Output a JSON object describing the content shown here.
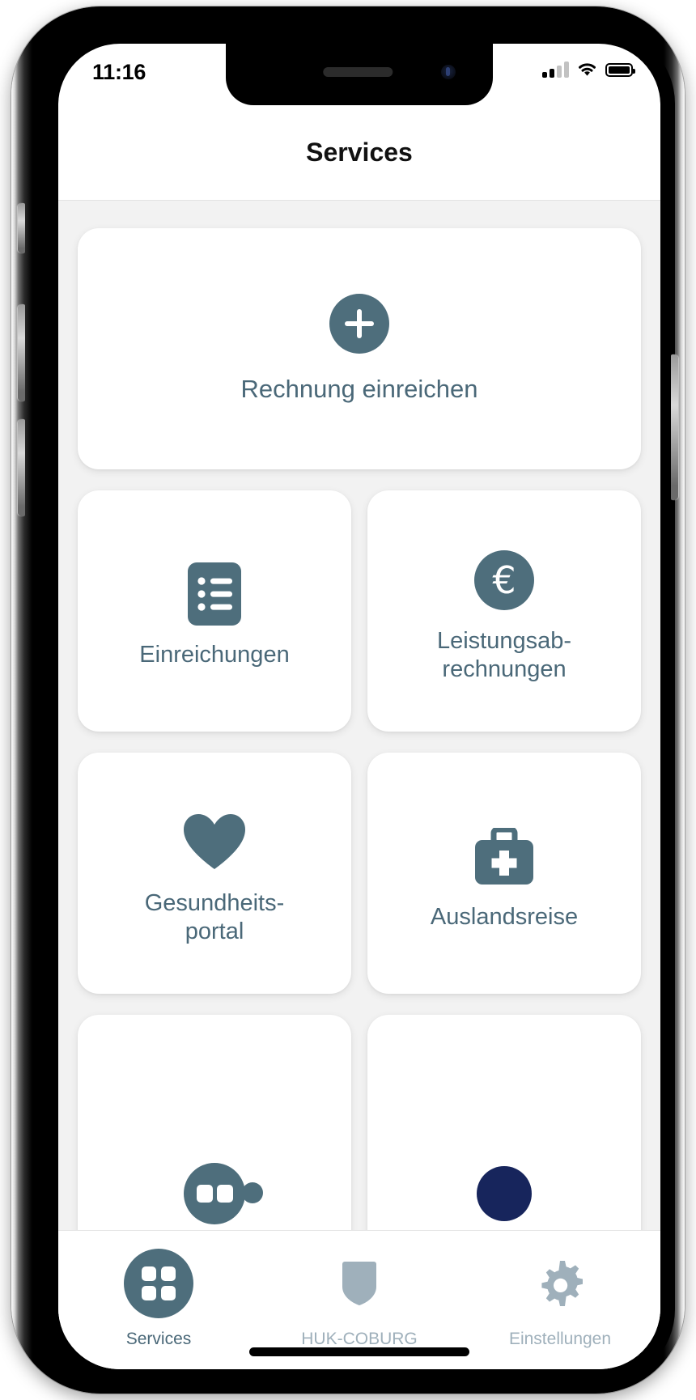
{
  "status_bar": {
    "time": "11:16",
    "signal_icon": "cellular-signal-icon",
    "wifi_icon": "wifi-icon",
    "battery_icon": "battery-icon"
  },
  "header": {
    "title": "Services"
  },
  "colors": {
    "accent": "#4e6e7c",
    "label": "#4a6878",
    "inactive": "#9fb0bb",
    "navy": "#17255c",
    "screen_bg": "#f2f2f2",
    "card_bg": "#ffffff"
  },
  "main": {
    "primary_card": {
      "label": "Rechnung einreichen",
      "icon": "plus-circle-icon"
    },
    "tiles": [
      {
        "label": "Einreichungen",
        "icon": "document-list-icon"
      },
      {
        "label": "Leistungsab-\nrechnungen",
        "icon": "euro-circle-icon"
      },
      {
        "label": "Gesundheits-\nportal",
        "icon": "heart-icon"
      },
      {
        "label": "Auslandsreise",
        "icon": "medical-bag-icon"
      }
    ],
    "partial_tiles": [
      {
        "icon": "teal-circle-icon"
      },
      {
        "icon": "navy-circle-icon"
      }
    ]
  },
  "tab_bar": {
    "tabs": [
      {
        "label": "Services",
        "icon": "grid-squares-icon",
        "active": true
      },
      {
        "label": "HUK-COBURG",
        "icon": "shield-icon",
        "active": false
      },
      {
        "label": "Einstellungen",
        "icon": "gear-icon",
        "active": false
      }
    ]
  }
}
